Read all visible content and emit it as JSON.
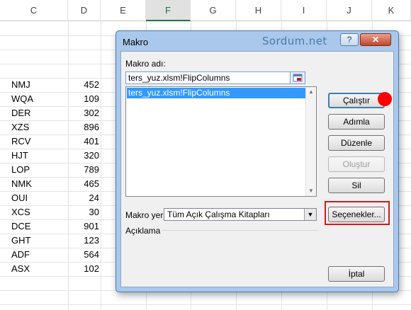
{
  "sheet": {
    "columns": [
      "C",
      "D",
      "E",
      "F",
      "G",
      "H",
      "I",
      "J",
      "K"
    ],
    "active_column": "F",
    "rows": [
      {
        "code": "NMJ",
        "value": "452"
      },
      {
        "code": "WQA",
        "value": "109"
      },
      {
        "code": "DER",
        "value": "302"
      },
      {
        "code": "XZS",
        "value": "896"
      },
      {
        "code": "RCV",
        "value": "401"
      },
      {
        "code": "HJT",
        "value": "320"
      },
      {
        "code": "LOP",
        "value": "789"
      },
      {
        "code": "NMK",
        "value": "465"
      },
      {
        "code": "OUI",
        "value": "24"
      },
      {
        "code": "XCS",
        "value": "30"
      },
      {
        "code": "DCE",
        "value": "901"
      },
      {
        "code": "GHT",
        "value": "123"
      },
      {
        "code": "ADF",
        "value": "564"
      },
      {
        "code": "ASX",
        "value": "102"
      }
    ]
  },
  "dialog": {
    "title": "Makro",
    "watermark": "Sordum.net",
    "help_label": "?",
    "close_label": "✕",
    "macro_name_label": "Makro adı:",
    "macro_name_value": "ters_yuz.xlsm!FlipColumns",
    "list_items": [
      "ters_yuz.xlsm!FlipColumns"
    ],
    "location_label": "Makro yeri:",
    "location_value": "Tüm Açık Çalışma Kitapları",
    "description_label": "Açıklama",
    "buttons": {
      "run": "Çalıştır",
      "step_into": "Adımla",
      "edit": "Düzenle",
      "create": "Oluştur",
      "delete": "Sil",
      "options": "Seçenekler...",
      "cancel": "İptal"
    }
  },
  "colors": {
    "highlight_border": "#d9171c",
    "selection": "#3399ff",
    "active_column": "#217346"
  }
}
